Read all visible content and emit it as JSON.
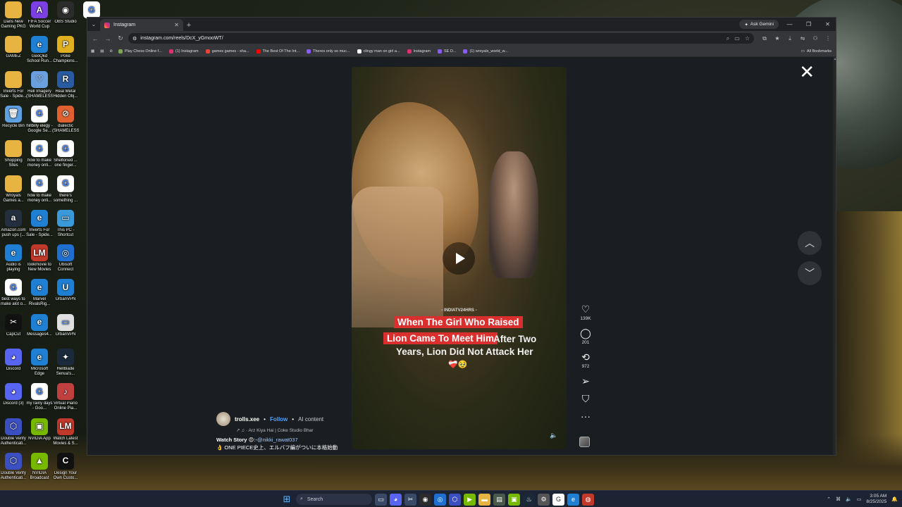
{
  "desktop": {
    "icons": [
      {
        "label": "Dans New Gaming PKG",
        "glyph": "",
        "color": "#e7b441"
      },
      {
        "label": "FIFA Soccer World Cup",
        "glyph": "A",
        "color": "#7b3fe4"
      },
      {
        "label": "OBS Studio",
        "glyph": "◉",
        "color": "#2b2b2b"
      },
      {
        "label": "",
        "glyph": "G",
        "color": "#ffffff"
      },
      {
        "label": "GAMEZ",
        "glyph": "",
        "color": "#e7b441"
      },
      {
        "label": "GeoQkd School Run...",
        "glyph": "e",
        "color": "#1f7fd3"
      },
      {
        "label": "Poké Champions...",
        "glyph": "P",
        "color": "#e0b020"
      },
      {
        "label": "Inverts For Sale - Spide...",
        "glyph": "",
        "color": "#e7b441"
      },
      {
        "label": "Hell Imagery (SHAMELESS)",
        "glyph": "♡",
        "color": "#6aa0e0"
      },
      {
        "label": "Real Metal Hidden Obj...",
        "glyph": "R",
        "color": "#2a5aa0"
      },
      {
        "label": "Recycle Bin",
        "glyph": "🗑",
        "color": "#5fa0e0"
      },
      {
        "label": "hillbilly elegy - Google Se...",
        "glyph": "G",
        "color": "#ffffff"
      },
      {
        "label": "dialectic (SHAMELESS)",
        "glyph": "⊘",
        "color": "#e06030"
      },
      {
        "label": "Shopping Sites",
        "glyph": "",
        "color": "#e7b441"
      },
      {
        "label": "how to make money onli...",
        "glyph": "G",
        "color": "#ffffff"
      },
      {
        "label": "Sheltoned ... one finger...",
        "glyph": "G",
        "color": "#ffffff"
      },
      {
        "label": "Wroyals Games a...",
        "glyph": "",
        "color": "#e7b441"
      },
      {
        "label": "how to make money onli...",
        "glyph": "G",
        "color": "#ffffff"
      },
      {
        "label": "there's something ...",
        "glyph": "G",
        "color": "#ffffff"
      },
      {
        "label": "Amazon.com push ups (...",
        "glyph": "a",
        "color": "#232f3e"
      },
      {
        "label": "Inverts For Sale - Spide...",
        "glyph": "e",
        "color": "#1f7fd3"
      },
      {
        "label": "This PC - Shortcut",
        "glyph": "▭",
        "color": "#3a9ad9"
      },
      {
        "label": "Audio is playing",
        "glyph": "e",
        "color": "#1f7fd3"
      },
      {
        "label": "lookmovie to New Movies",
        "glyph": "LM",
        "color": "#c0392b"
      },
      {
        "label": "Ubisoft Connect",
        "glyph": "◎",
        "color": "#1f6fd0"
      },
      {
        "label": "best ways to make alot o...",
        "glyph": "G",
        "color": "#ffffff"
      },
      {
        "label": "Marvel RivalsRig...",
        "glyph": "e",
        "color": "#1f7fd3"
      },
      {
        "label": "UrbanVPN",
        "glyph": "U",
        "color": "#1f7fd3"
      },
      {
        "label": "CapCut",
        "glyph": "✂",
        "color": "#111111"
      },
      {
        "label": "Messages4...",
        "glyph": "e",
        "color": "#1f7fd3"
      },
      {
        "label": "UrbanVPN",
        "glyph": "▭",
        "color": "#e0e0e0"
      },
      {
        "label": "Discord",
        "glyph": "◕",
        "color": "#5865f2"
      },
      {
        "label": "Microsoft Edge",
        "glyph": "e",
        "color": "#1f7fd3"
      },
      {
        "label": "Hellblade Senua's...",
        "glyph": "✦",
        "color": "#1a2a3a"
      },
      {
        "label": "Discord (3)",
        "glyph": "◕",
        "color": "#5865f2"
      },
      {
        "label": "my rainy days - Goo...",
        "glyph": "G",
        "color": "#ffffff"
      },
      {
        "label": "Virtual Piano Online Pia...",
        "glyph": "♪",
        "color": "#c04040"
      },
      {
        "label": "Double Verify Authenticati...",
        "glyph": "⬡",
        "color": "#3a50c0"
      },
      {
        "label": "NVIDIA App",
        "glyph": "▣",
        "color": "#76b900"
      },
      {
        "label": "Watch Latest Movies & S...",
        "glyph": "LM",
        "color": "#c0392b"
      },
      {
        "label": "Double Verify Authenticati...",
        "glyph": "⬡",
        "color": "#3a50c0"
      },
      {
        "label": "NVIDIA Broadcast",
        "glyph": "▲",
        "color": "#76b900"
      },
      {
        "label": "Design Your Own Custo...",
        "glyph": "C",
        "color": "#111111"
      }
    ]
  },
  "browser": {
    "tab_title": "Instagram",
    "gemini_label": "Ask Gemini",
    "url": "instagram.com/reels/DcX_yGmooWT/",
    "bookmarks": [
      {
        "label": "Play Chess Online f...",
        "color": "#7fa650"
      },
      {
        "label": "(1) Instagram",
        "color": "#e1306c"
      },
      {
        "label": "games games - sha...",
        "color": "#ea4335"
      },
      {
        "label": "The Best Of The Int...",
        "color": "#ff0000"
      },
      {
        "label": "Theres only so muc...",
        "color": "#8a5cf6"
      },
      {
        "label": "clingy man on girl a...",
        "color": "#ffffff"
      },
      {
        "label": "Instagram",
        "color": "#e1306c"
      },
      {
        "label": "SE D...",
        "color": "#8a5cf6"
      },
      {
        "label": "(1) wroyals_world_w...",
        "color": "#8a5cf6"
      }
    ],
    "all_bookmarks": "All Bookmarks"
  },
  "reel": {
    "source_tag": "- INDIATV24HRS -",
    "caption_line1": "When The Girl Who Raised",
    "caption_line2": "Lion Came To Meet Him",
    "caption_line3": "After Two",
    "caption_line4": "Years, Lion Did Not Attack Her",
    "caption_emoji": "❤️‍🩹🥹",
    "author": {
      "username": "trolls.xee",
      "follow": "Follow",
      "ai_tag": "AI content",
      "music": "↗ ♫ · Arz Kiya Hai | Coke Studio Bhar"
    },
    "description_bold": "Watch Story",
    "description_mention": "@nikki_rawat037",
    "description_rest": "👌 ONE PIECE史上、エルバフ編がついに本格始動——。...",
    "actions": {
      "likes": "139K",
      "comments": "201",
      "reposts": "972"
    }
  },
  "taskbar": {
    "search_placeholder": "Search",
    "time": "3:05 AM",
    "date": "8/25/2025"
  }
}
